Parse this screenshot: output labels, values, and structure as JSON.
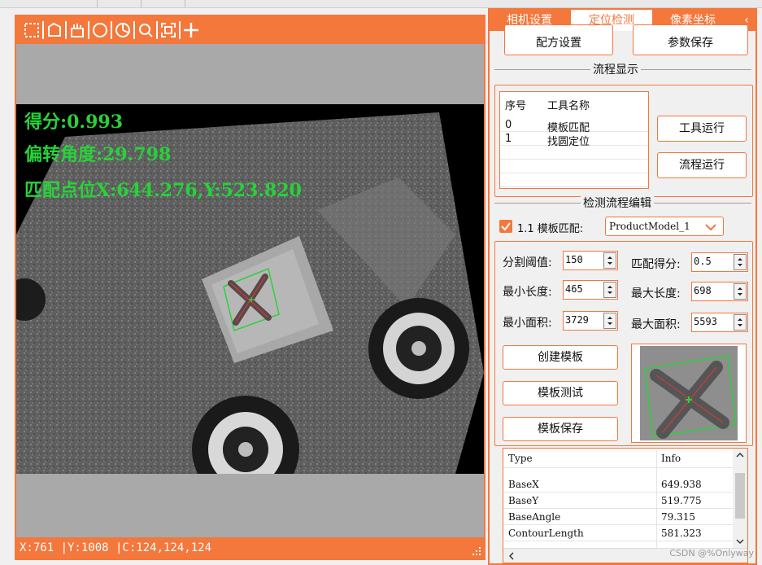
{
  "viewer": {
    "overlay": {
      "score": "得分:0.993",
      "angle": "偏转角度:29.798",
      "match_point": "匹配点位X:644.276,Y:523.820"
    },
    "status": "X:761 |Y:1008 |C:124,124,124",
    "toolbar_icons": [
      "rect-select-icon",
      "polygon-select-icon",
      "brush-icon",
      "circle-select-icon",
      "pie-select-icon",
      "zoom-fit-icon",
      "fullscreen-icon",
      "crosshair-icon"
    ]
  },
  "tabs": [
    {
      "label": "相机设置",
      "active": false
    },
    {
      "label": "定位检测",
      "active": true
    },
    {
      "label": "像素坐标",
      "active": false
    }
  ],
  "top_buttons": {
    "recipe": "配方设置",
    "save_params": "参数保存"
  },
  "flow_display": {
    "title": "流程显示",
    "columns": [
      "序号",
      "工具名称"
    ],
    "rows": [
      [
        "0",
        "模板匹配"
      ],
      [
        "1",
        "找圆定位"
      ]
    ],
    "run_tool": "工具运行",
    "run_flow": "流程运行"
  },
  "flow_edit": {
    "title": "检测流程编辑",
    "step_label": "1.1 模板匹配:",
    "model_select": "ProductModel_1",
    "fields": {
      "seg_threshold": {
        "label": "分割阈值:",
        "value": "150"
      },
      "match_score": {
        "label": "匹配得分:",
        "value": "0.5"
      },
      "min_length": {
        "label": "最小长度:",
        "value": "465"
      },
      "max_length": {
        "label": "最大长度:",
        "value": "698"
      },
      "min_area": {
        "label": "最小面积:",
        "value": "3729"
      },
      "max_area": {
        "label": "最大面积:",
        "value": "5593"
      }
    },
    "create_model": "创建模板",
    "test_model": "模板测试",
    "save_model": "模板保存"
  },
  "info_table": {
    "columns": [
      "Type",
      "Info"
    ],
    "rows": [
      [
        "BaseX",
        "649.938"
      ],
      [
        "BaseY",
        "519.775"
      ],
      [
        "BaseAngle",
        "79.315"
      ],
      [
        "ContourLength",
        "581.323"
      ]
    ]
  },
  "watermark": "CSDN @%Onlyway",
  "colors": {
    "accent": "#f4773c",
    "overlay_text": "#28d23a"
  }
}
